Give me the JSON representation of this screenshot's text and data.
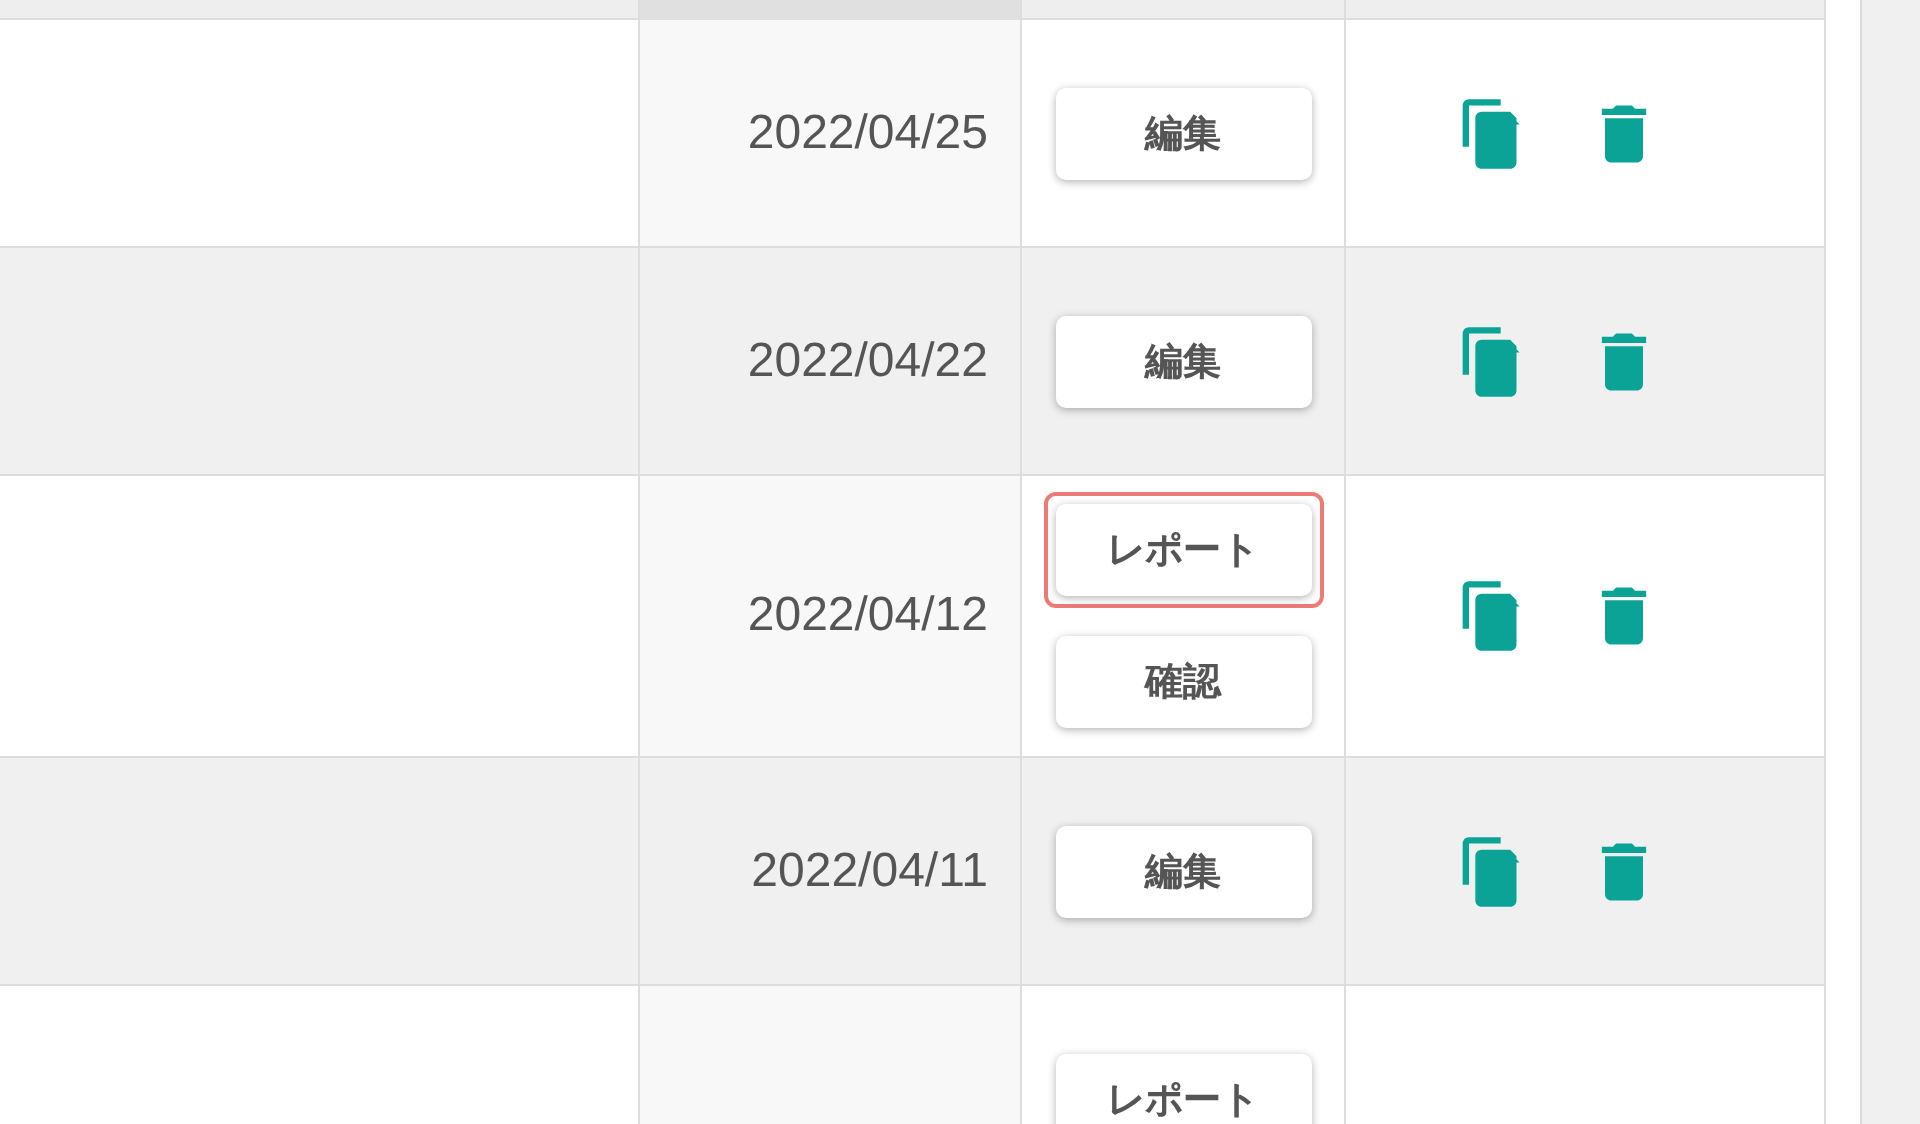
{
  "rows": [
    {
      "date": "2022/04/25",
      "buttons": [
        {
          "label": "編集",
          "focused": false
        }
      ],
      "actions": [
        {
          "kind": "copy"
        },
        {
          "kind": "delete"
        }
      ]
    },
    {
      "date": "2022/04/22",
      "buttons": [
        {
          "label": "編集",
          "focused": false
        }
      ],
      "actions": [
        {
          "kind": "copy"
        },
        {
          "kind": "delete"
        }
      ]
    },
    {
      "date": "2022/04/12",
      "buttons": [
        {
          "label": "レポート",
          "focused": true
        },
        {
          "label": "確認",
          "focused": false
        }
      ],
      "actions": [
        {
          "kind": "copy"
        },
        {
          "kind": "delete"
        }
      ]
    },
    {
      "date": "2022/04/11",
      "buttons": [
        {
          "label": "編集",
          "focused": false
        }
      ],
      "actions": [
        {
          "kind": "copy"
        },
        {
          "kind": "delete"
        }
      ]
    },
    {
      "buttons": [
        {
          "label": "レポート",
          "focused": false
        }
      ]
    }
  ]
}
